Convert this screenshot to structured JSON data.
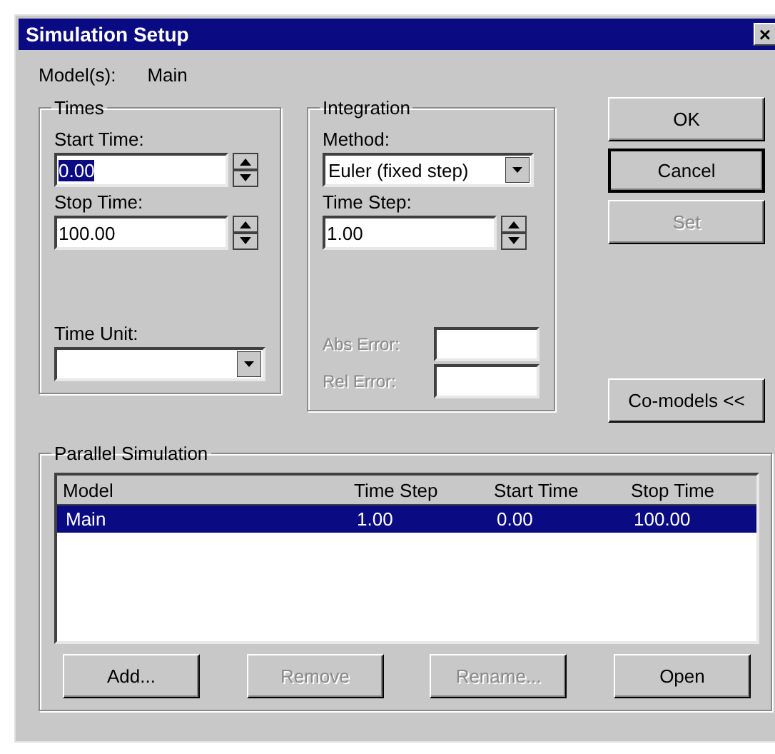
{
  "window": {
    "title": "Simulation Setup",
    "close": "×"
  },
  "models": {
    "label": "Model(s):",
    "value": "Main"
  },
  "times": {
    "title": "Times",
    "fields": [
      {
        "label": "Start Time:",
        "value": "0.00",
        "selected": true
      },
      {
        "label": "Stop Time:",
        "value": "100.00",
        "selected": false
      }
    ],
    "unit": {
      "label": "Time Unit:"
    }
  },
  "integration": {
    "title": "Integration",
    "method": {
      "label": "Method:",
      "value": "Euler (fixed step)"
    },
    "time_step": {
      "label": "Time Step:",
      "value": "1.00"
    },
    "errors": [
      {
        "label": "Abs Error:",
        "disabled": true
      },
      {
        "label": "Rel Error:",
        "disabled": true
      }
    ]
  },
  "buttons": [
    {
      "label": "OK",
      "disabled": false,
      "default": false
    },
    {
      "label": "Cancel",
      "disabled": false,
      "default": true
    },
    {
      "label": "Set",
      "disabled": true,
      "default": false
    }
  ],
  "comodels": {
    "label": "Co-models <<"
  },
  "parallel": {
    "title": "Parallel Simulation",
    "columns": [
      "Model",
      "Time Step",
      "Start Time",
      "Stop Time"
    ],
    "rows": [
      {
        "cells": [
          "Main",
          "1.00",
          "0.00",
          "100.00"
        ],
        "selected": true
      }
    ],
    "buttons": [
      {
        "label": "Add...",
        "disabled": false
      },
      {
        "label": "Remove",
        "disabled": true
      },
      {
        "label": "Rename...",
        "disabled": true
      },
      {
        "label": "Open",
        "disabled": false
      }
    ]
  }
}
